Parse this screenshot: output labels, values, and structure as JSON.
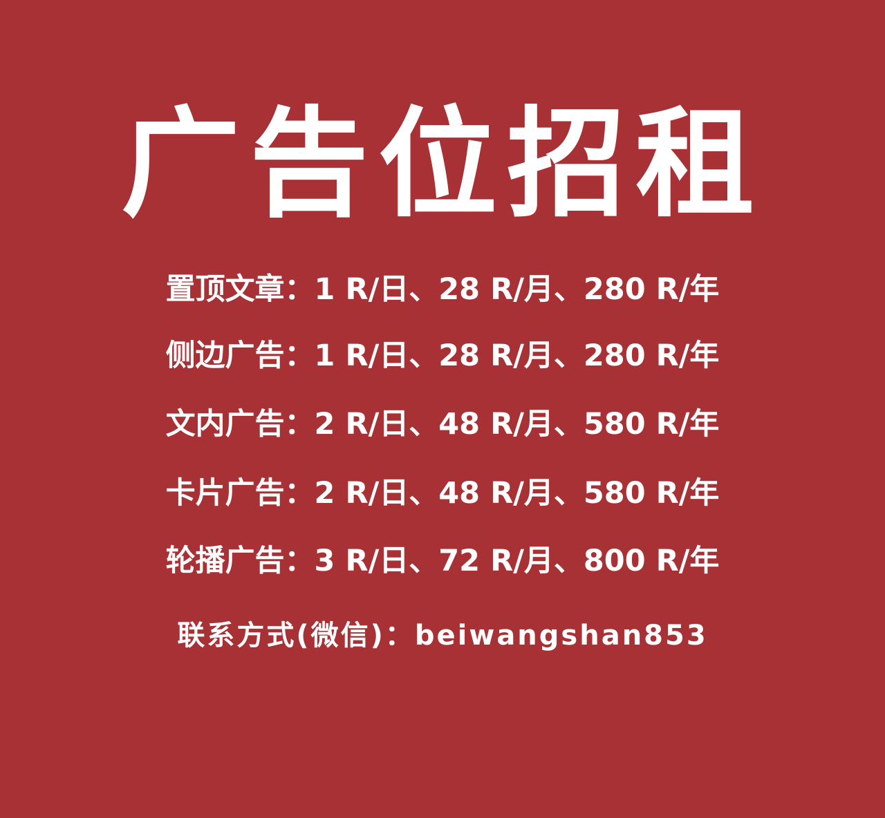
{
  "colors": {
    "background": "#a73134",
    "text": "#ffffff"
  },
  "headline": "广告位招租",
  "price_rows": [
    {
      "label": "置顶文章",
      "text": "置顶文章：1 R/日、28 R/月、280 R/年"
    },
    {
      "label": "侧边广告",
      "text": "侧边广告：1 R/日、28 R/月、280 R/年"
    },
    {
      "label": "文内广告",
      "text": "文内广告：2 R/日、48 R/月、580 R/年"
    },
    {
      "label": "卡片广告",
      "text": "卡片广告：2 R/日、48 R/月、580 R/年"
    },
    {
      "label": "轮播广告",
      "text": "轮播广告：3 R/日、72 R/月、800 R/年"
    }
  ],
  "contact": "联系方式(微信)：beiwangshan853"
}
